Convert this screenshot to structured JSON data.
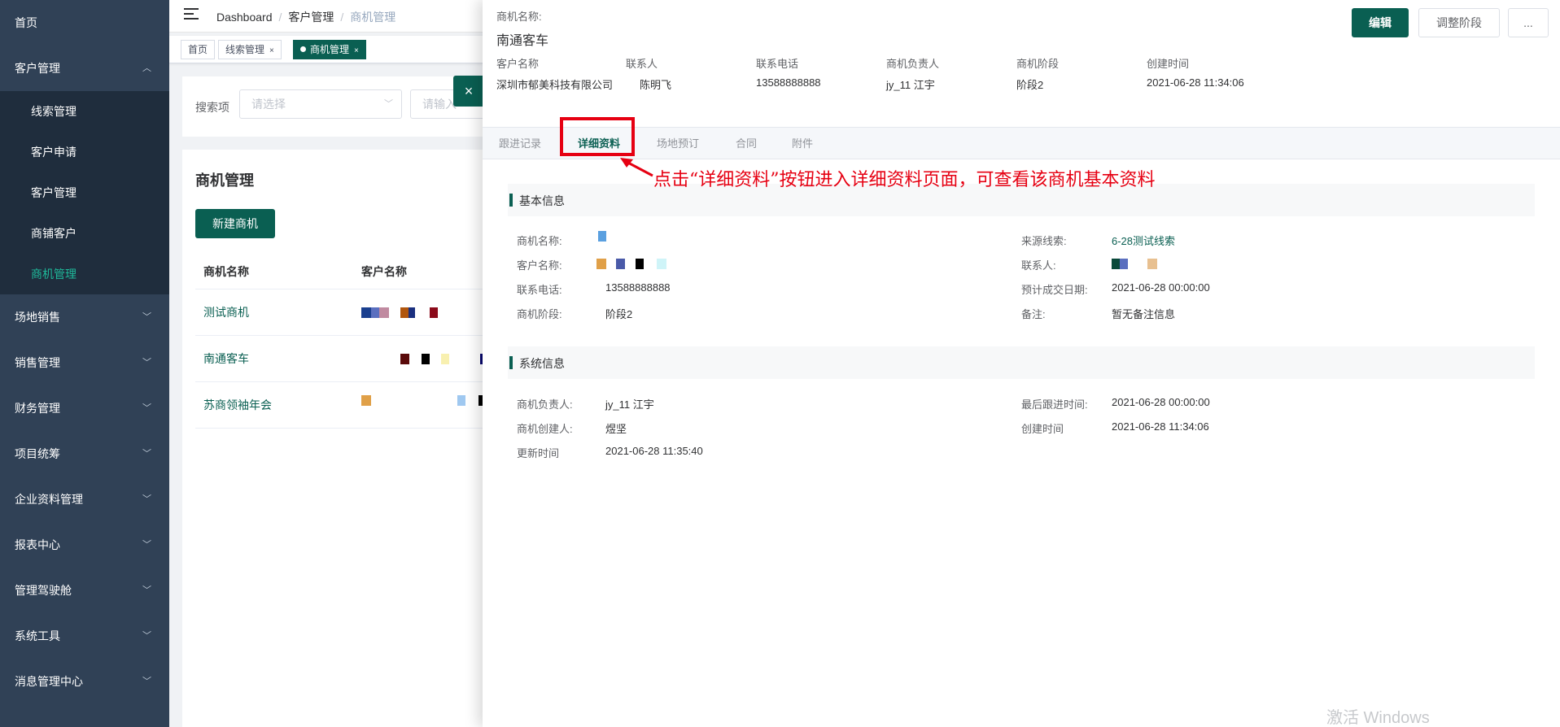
{
  "sidebar": {
    "items": [
      {
        "label": "首页"
      },
      {
        "label": "客户管理"
      },
      {
        "label": "场地销售"
      },
      {
        "label": "销售管理"
      },
      {
        "label": "财务管理"
      },
      {
        "label": "项目统筹"
      },
      {
        "label": "企业资料管理"
      },
      {
        "label": "报表中心"
      },
      {
        "label": "管理驾驶舱"
      },
      {
        "label": "系统工具"
      },
      {
        "label": "消息管理中心"
      }
    ],
    "sub_items": [
      {
        "label": "线索管理"
      },
      {
        "label": "客户申请"
      },
      {
        "label": "客户管理"
      },
      {
        "label": "商铺客户"
      },
      {
        "label": "商机管理",
        "active": true
      }
    ],
    "colors": {
      "bg": "#304156",
      "sub_bg": "#1f2d3d",
      "active": "#1fb99a"
    }
  },
  "breadcrumb": [
    "Dashboard",
    "客户管理",
    "商机管理"
  ],
  "tags": [
    {
      "label": "首页"
    },
    {
      "label": "线索管理"
    },
    {
      "label": "商机管理",
      "active": true
    }
  ],
  "search": {
    "label": "搜索项",
    "select_placeholder": "请选择",
    "input_placeholder": "请输入"
  },
  "list": {
    "title": "商机管理",
    "new_button": "新建商机",
    "columns": [
      "商机名称",
      "客户名称"
    ],
    "rows": [
      {
        "name": "测试商机"
      },
      {
        "name": "南通客车"
      },
      {
        "name": "苏商领袖年会"
      }
    ]
  },
  "drawer": {
    "name_label": "商机名称:",
    "name": "南通客车",
    "buttons": {
      "edit": "编辑",
      "adjust": "调整阶段",
      "more": "..."
    },
    "meta": [
      {
        "key": "客户名称",
        "value": "深圳市郁美科技有限公司"
      },
      {
        "key": "联系人",
        "value": "陈明飞"
      },
      {
        "key": "联系电话",
        "value": "13588888888"
      },
      {
        "key": "商机负责人",
        "value": "jy_11 江宇"
      },
      {
        "key": "商机阶段",
        "value": "阶段2"
      },
      {
        "key": "创建时间",
        "value": "2021-06-28 11:34:06"
      }
    ],
    "tabs": [
      "跟进记录",
      "详细资料",
      "场地预订",
      "合同",
      "附件"
    ],
    "active_tab": "详细资料",
    "annotation": "点击“详细资料”按钮进入详细资料页面，可查看该商机基本资料",
    "basic": {
      "title": "基本信息",
      "left": [
        {
          "key": "商机名称:",
          "value": ""
        },
        {
          "key": "客户名称:",
          "value": ""
        },
        {
          "key": "联系电话:",
          "value": "13588888888"
        },
        {
          "key": "商机阶段:",
          "value": "阶段2"
        }
      ],
      "right": [
        {
          "key": "来源线索:",
          "value": "6-28测试线索"
        },
        {
          "key": "联系人:",
          "value": ""
        },
        {
          "key": "预计成交日期:",
          "value": "2021-06-28 00:00:00"
        },
        {
          "key": "备注:",
          "value": "暂无备注信息"
        }
      ]
    },
    "system": {
      "title": "系统信息",
      "left": [
        {
          "key": "商机负责人:",
          "value": "jy_11 江宇"
        },
        {
          "key": "商机创建人:",
          "value": "煜坚"
        },
        {
          "key": "更新时间",
          "value": "2021-06-28 11:35:40"
        }
      ],
      "right": [
        {
          "key": "最后跟进时间:",
          "value": "2021-06-28 00:00:00"
        },
        {
          "key": "创建时间",
          "value": "2021-06-28 11:34:06"
        }
      ]
    }
  },
  "watermark": "激活 Windows",
  "colors": {
    "primary": "#0a5f52",
    "annotation": "#e60012"
  }
}
